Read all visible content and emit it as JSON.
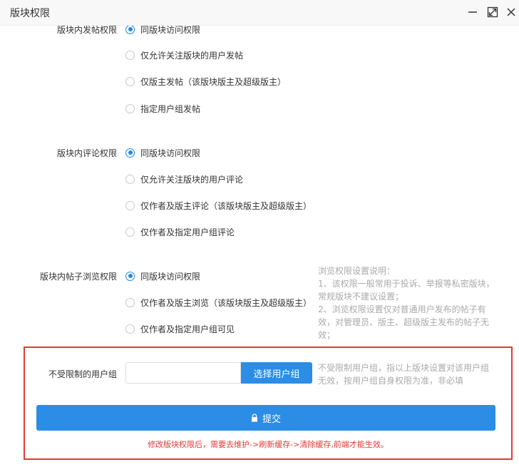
{
  "window": {
    "title": "版块权限",
    "controls": [
      "minimize-icon",
      "maximize-icon",
      "close-icon"
    ]
  },
  "sections": [
    {
      "label": "版块内发帖权限",
      "options": [
        {
          "label": "同版块访问权限",
          "checked": true
        },
        {
          "label": "仅允许关注版块的用户发帖",
          "checked": false
        },
        {
          "label": "仅版主发帖（该版块版主及超级版主）",
          "checked": false
        },
        {
          "label": "指定用户组发帖",
          "checked": false
        }
      ]
    },
    {
      "label": "版块内评论权限",
      "options": [
        {
          "label": "同版块访问权限",
          "checked": true
        },
        {
          "label": "仅允许关注版块的用户评论",
          "checked": false
        },
        {
          "label": "仅作者及版主评论（该版块版主及超级版主）",
          "checked": false
        },
        {
          "label": "仅作者及指定用户组评论",
          "checked": false
        }
      ]
    },
    {
      "label": "版块内帖子浏览权限",
      "options": [
        {
          "label": "同版块访问权限",
          "checked": true
        },
        {
          "label": "仅作者及版主浏览（该版块版主及超级版主）",
          "checked": false
        },
        {
          "label": "仅作者及指定用户组可见",
          "checked": false
        }
      ]
    }
  ],
  "browse_note": [
    "浏览权限设置说明：",
    "1、该权限一般常用于投诉、举报等私密版块，",
    "常规版块不建议设置；",
    "2、浏览权限设置仅对普通用户发布的帖子有",
    "效，对管理员、版主、超级版主发布的帖子无",
    "效；"
  ],
  "unrestricted": {
    "label": "不受限制的用户组",
    "input_value": "",
    "button_label": "选择用户组",
    "note": [
      "不受限制用户组，指以上版块设置对该用户组",
      "无效，按用户组自身权限为准，非必填"
    ]
  },
  "submit_label": "提交",
  "warning": "修改版块权限后，需要去维护->刷新缓存->清除缓存,前端才能生效。",
  "colors": {
    "accent": "#2b8de6",
    "warning": "#e53935",
    "note": "#aaaaaa"
  }
}
